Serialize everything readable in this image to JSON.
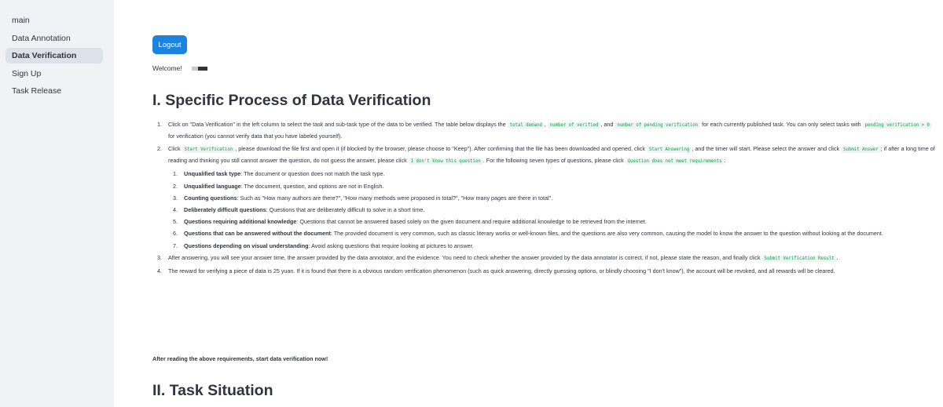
{
  "sidebar": {
    "items": [
      {
        "label": "main",
        "active": false
      },
      {
        "label": "Data Annotation",
        "active": false
      },
      {
        "label": "Data Verification",
        "active": true
      },
      {
        "label": "Sign Up",
        "active": false
      },
      {
        "label": "Task Release",
        "active": false
      }
    ]
  },
  "header": {
    "logout_label": "Logout",
    "welcome_text": "Welcome!"
  },
  "section1": {
    "title": "I. Specific Process of Data Verification",
    "step1": {
      "t1": "Click on \"Data Verification\" in the left column to select the task and sub-task type of the data to be verified. The table below displays the ",
      "c1": "total demand",
      "t2": ", ",
      "c2": "number of verified",
      "t3": ", and ",
      "c3": "number of pending verification",
      "t4": " for each currently published task. You can only select tasks with ",
      "c4": "pending verification > 0",
      "t5": " for verification (you cannot verify data that you have labeled yourself)."
    },
    "step2": {
      "t1": "Click ",
      "c1": "Start Verification",
      "t2": ", please download the file first and open it (if blocked by the browser, please choose to \"Keep\"). After confirming that the file has been downloaded and opened, click ",
      "c2": "Start Answering",
      "t3": ", and the timer will start. Please select the answer and click ",
      "c3": "Submit Answer",
      "t4": "; if after a long time of reading and thinking you still cannot answer the question, do not guess the answer, please click ",
      "c4": "I don't know this question",
      "t5": ". For the following seven types of questions, please click ",
      "c5": "Question does not meet requirements",
      "t6": ":",
      "subitems": [
        {
          "bold": "Unqualified task type",
          "text": ": The document or question does not match the task type."
        },
        {
          "bold": "Unqualified language",
          "text": ": The document, question, and options are not in English."
        },
        {
          "bold": "Counting questions",
          "text": ": Such as \"How many authors are there?\", \"How many methods were proposed in total?\", \"How many pages are there in total\"."
        },
        {
          "bold": "Deliberately difficult questions",
          "text": ": Questions that are deliberately difficult to solve in a short time."
        },
        {
          "bold": "Questions requiring additional knowledge",
          "text": ": Questions that cannot be answered based solely on the given document and require additional knowledge to be retrieved from the internet."
        },
        {
          "bold": "Questions that can be answered without the document",
          "text": ": The provided document is very common, such as classic literary works or well-known files, and the questions are also very common, causing the model to know the answer to the question without looking at the document."
        },
        {
          "bold": "Questions depending on visual understanding",
          "text": ": Avoid asking questions that require looking at pictures to answer."
        }
      ]
    },
    "step3": {
      "t1": "After answering, you will see your answer time, the answer provided by the data annotator, and the evidence. You need to check whether the answer provided by the data annotator is correct, if not, please state the reason, and finally click ",
      "c1": "Submit Verification Result",
      "t2": "."
    },
    "step4": {
      "t1": "The reward for verifying a piece of data is 25 yuan. If it is found that there is a obvious random verification phenomenon (such as quick answering, directly guessing options, or blindly choosing \"I don't know\"), the account will be revoked, and all rewards will be cleared."
    },
    "closing": "After reading the above requirements, start data verification now!"
  },
  "section2": {
    "title": "II. Task Situation"
  },
  "colors": {
    "accent": "#1c83e1",
    "code_text": "#09ab3b",
    "sidebar_bg": "#f0f2f6"
  }
}
